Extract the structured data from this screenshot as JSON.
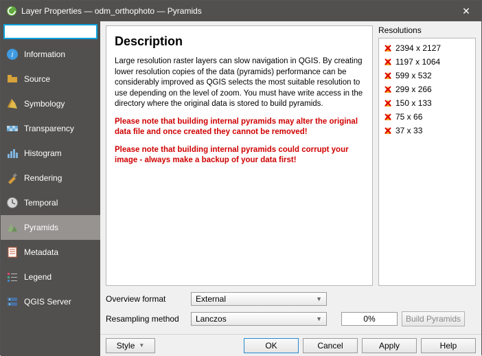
{
  "window": {
    "title": "Layer Properties — odm_orthophoto — Pyramids"
  },
  "search": {
    "placeholder": ""
  },
  "sidebar": {
    "items": [
      {
        "label": "Information",
        "icon": "info-icon"
      },
      {
        "label": "Source",
        "icon": "source-icon"
      },
      {
        "label": "Symbology",
        "icon": "symbology-icon"
      },
      {
        "label": "Transparency",
        "icon": "transparency-icon"
      },
      {
        "label": "Histogram",
        "icon": "histogram-icon"
      },
      {
        "label": "Rendering",
        "icon": "rendering-icon"
      },
      {
        "label": "Temporal",
        "icon": "temporal-icon"
      },
      {
        "label": "Pyramids",
        "icon": "pyramids-icon"
      },
      {
        "label": "Metadata",
        "icon": "metadata-icon"
      },
      {
        "label": "Legend",
        "icon": "legend-icon"
      },
      {
        "label": "QGIS Server",
        "icon": "server-icon"
      }
    ],
    "active_index": 7
  },
  "description": {
    "heading": "Description",
    "body": "Large resolution raster layers can slow navigation in QGIS. By creating lower resolution copies of the data (pyramids) performance can be considerably improved as QGIS selects the most suitable resolution to use depending on the level of zoom. You must have write access in the directory where the original data is stored to build pyramids.",
    "warn1": "Please note that building internal pyramids may alter the original data file and once created they cannot be removed!",
    "warn2": "Please note that building internal pyramids could corrupt your image - always make a backup of your data first!"
  },
  "resolutions": {
    "label": "Resolutions",
    "items": [
      "2394 x 2127",
      "1197 x 1064",
      "599 x 532",
      "299 x 266",
      "150 x 133",
      "75 x 66",
      "37 x 33"
    ]
  },
  "form": {
    "overview_label": "Overview format",
    "overview_value": "External",
    "resample_label": "Resampling method",
    "resample_value": "Lanczos",
    "progress": "0%",
    "build_label": "Build Pyramids"
  },
  "footer": {
    "style": "Style",
    "ok": "OK",
    "cancel": "Cancel",
    "apply": "Apply",
    "help": "Help"
  },
  "colors": {
    "brand_green": "#60a93f",
    "accent_blue": "#0aa1dd"
  }
}
